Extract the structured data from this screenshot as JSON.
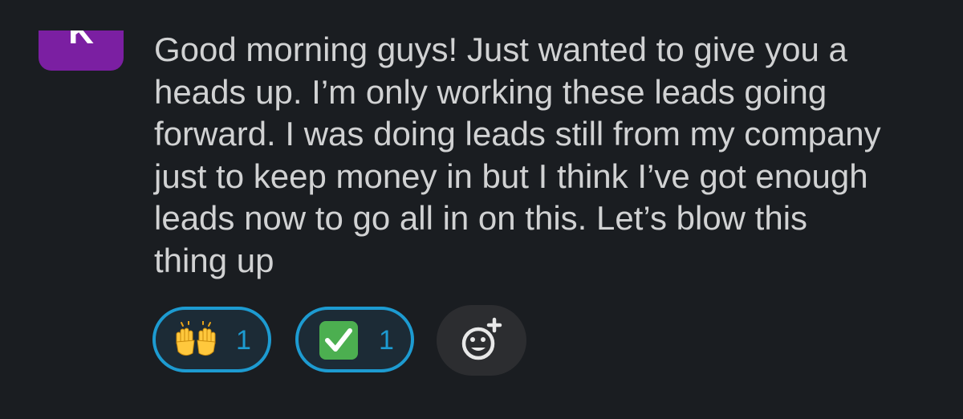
{
  "message": {
    "avatar_initial": "K",
    "avatar_color": "#7b1fa2",
    "text": "Good morning guys! Just wanted to give you a\nheads up. I’m only working these leads going\nforward. I was doing leads still from my company\njust to keep money in but I think I’ve got enough\nleads now to go all in on this. Let’s blow this\nthing up"
  },
  "reactions": [
    {
      "emoji": "raising-hands",
      "count": "1"
    },
    {
      "emoji": "white-check-mark",
      "count": "1"
    }
  ],
  "add_reaction": {
    "icon": "add-reaction-icon"
  },
  "colors": {
    "background": "#1a1d21",
    "text": "#d1d2d3",
    "reaction_border": "#1d9bd1",
    "reaction_count": "#1d9bd1",
    "check_green": "#4caf50"
  }
}
